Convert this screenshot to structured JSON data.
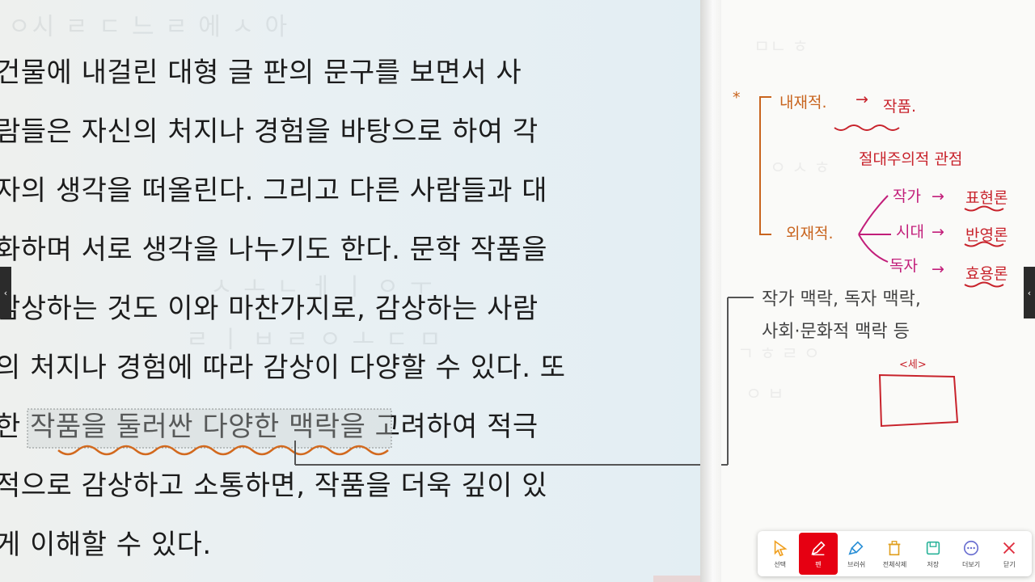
{
  "page_text": {
    "lines": [
      "  건물에 내걸린 대형 글 판의 문구를 보면서 사",
      "람들은 자신의 처지나 경험을 바탕으로 하여 각",
      "자의 생각을 떠올린다. 그리고 다른 사람들과 대",
      "화하며 서로 생각을 나누기도 한다. 문학 작품을",
      "감상하는 것도 이와 마찬가지로, 감상하는 사람",
      "의 처지나 경험에 따라 감상이 다양할 수 있다. 또",
      "한 작품을 둘러싼 다양한 맥락을 고려하여 적극",
      "적으로 감상하고 소통하면, 작품을 더욱 깊이 있",
      "게 이해할 수 있다."
    ]
  },
  "side_note": {
    "line1": "작가 맥락, 독자 맥락,",
    "line2": "사회·문화적 맥락 등"
  },
  "handwriting": {
    "star": "*",
    "internal": "내재적.",
    "internal_arrow": "→",
    "work": "작품.",
    "absolutist": "절대주의적 관점",
    "external": "외재적.",
    "author": "작가",
    "author_view": "표현론",
    "era": "시대",
    "era_view": "반영론",
    "reader": "독자",
    "reader_view": "효용론",
    "box_label": "<세>"
  },
  "toolbar": {
    "items": [
      {
        "label": "선택",
        "icon": "cursor-icon"
      },
      {
        "label": "펜",
        "icon": "pen-icon",
        "active": true
      },
      {
        "label": "브러쉬",
        "icon": "brush-icon"
      },
      {
        "label": "전체삭제",
        "icon": "trash-icon"
      },
      {
        "label": "저장",
        "icon": "save-icon"
      },
      {
        "label": "더보기",
        "icon": "more-icon"
      },
      {
        "label": "닫기",
        "icon": "close-icon"
      }
    ],
    "active_color": "#e60012"
  },
  "nav": {
    "left_glyph": "‹",
    "right_glyph": "‹"
  },
  "colors": {
    "ink_red": "#c8232c",
    "ink_orange": "#c8641e",
    "ink_magenta": "#c21e7a"
  }
}
